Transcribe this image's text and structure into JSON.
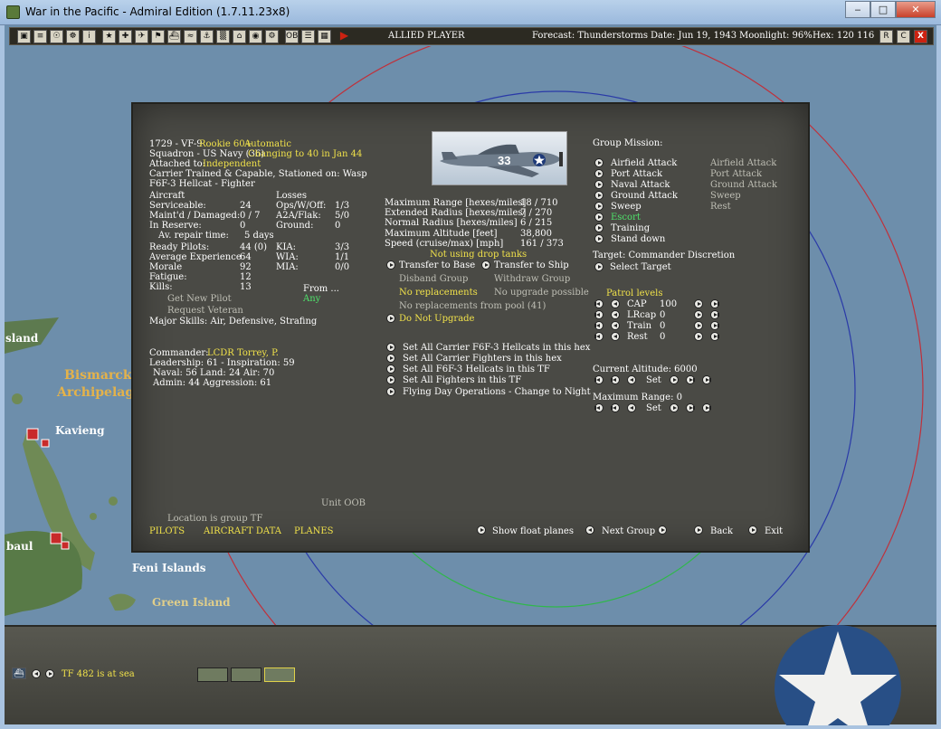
{
  "window": {
    "title": "War in the Pacific - Admiral Edition (1.7.11.23x8)",
    "min": "‒",
    "max": "□",
    "close": "✕"
  },
  "toolbar": {
    "player": "ALLIED PLAYER",
    "forecast": "Forecast: Thunderstorms",
    "date": "Date: Jun 19, 1943",
    "moonlight": "Moonlight: 96%",
    "hex": "Hex: 120 116",
    "icons": [
      "▣",
      "≡",
      "☉",
      "☸",
      "i",
      "★",
      "✚",
      "✈",
      "⚑",
      "⛴",
      "≈",
      "⚓",
      "▒",
      "⌂",
      "◉",
      "⚙",
      "OB",
      "☰",
      "▦"
    ],
    "right_icons": [
      "R",
      "C",
      "X"
    ]
  },
  "map": {
    "labels": {
      "island": "sland",
      "bismarck1": "Bismarck",
      "bismarck2": "Archipelago",
      "kavieng": "Kavieng",
      "rabaul": "baul",
      "feni": "Feni Islands",
      "green": "Green Island"
    }
  },
  "unit": {
    "line1_id": "1729 - VF-9",
    "line1_status": "Rookie 60+",
    "line1_mode": "Automatic",
    "squadron": "Squadron - US Navy (36)",
    "changing": "Changing to 40 in Jan 44",
    "attached_label": "Attached to:",
    "attached_value": "Independent",
    "carrier": "Carrier Trained & Capable, Stationed on:  Wasp",
    "aircraft_type": "F6F-3 Hellcat - Fighter"
  },
  "stats": {
    "aircraft_hdr": "Aircraft",
    "losses_hdr": "Losses",
    "serviceable_l": "Serviceable:",
    "serviceable_v": "24",
    "maintd_l": "Maint'd / Damaged:",
    "maintd_v": "0 / 7",
    "reserve_l": "In Reserve:",
    "reserve_v": "0",
    "repair_l": "Av. repair time:",
    "repair_v": "5 days",
    "opsw_l": "Ops/W/Off:",
    "opsw_v": "1/3",
    "a2a_l": "A2A/Flak:",
    "a2a_v": "5/0",
    "ground_l": "Ground:",
    "ground_v": "0",
    "ready_l": "Ready Pilots:",
    "ready_v": "44 (0)",
    "avgexp_l": "Average Experience",
    "avgexp_v": "64",
    "morale_l": "Morale",
    "morale_v": "92",
    "fatigue_l": "Fatigue:",
    "fatigue_v": "12",
    "kills_l": "Kills:",
    "kills_v": "13",
    "kia_l": "KIA:",
    "kia_v": "3/3",
    "wia_l": "WIA:",
    "wia_v": "1/1",
    "mia_l": "MIA:",
    "mia_v": "0/0",
    "get_pilot": "Get New Pilot",
    "req_vet": "Request Veteran",
    "from": "From ...",
    "any": "Any",
    "skills": "Major Skills:  Air, Defensive, Strafing"
  },
  "commander": {
    "label": "Commander:",
    "name": "LCDR Torrey, P.",
    "leadership": "Leadership: 61 - Inspiration: 59",
    "naval": "Naval:  56  Land:  24  Air:  70",
    "admin": "Admin:  44  Aggression:  61"
  },
  "performance": {
    "range_l": "Maximum Range [hexes/miles]",
    "range_v": "18 / 710",
    "ext_l": "Extended Radius [hexes/miles]",
    "ext_v": "7 / 270",
    "norm_l": "Normal Radius [hexes/miles]",
    "norm_v": "6 / 215",
    "alt_l": "Maximum Altitude [feet]",
    "alt_v": "38,800",
    "speed_l": "Speed (cruise/max) [mph]",
    "speed_v": "161 / 373",
    "drop_tanks": "Not using drop tanks"
  },
  "transfer": {
    "to_base": "Transfer to Base",
    "to_ship": "Transfer to Ship",
    "disband": "Disband Group",
    "withdraw": "Withdraw Group",
    "no_repl": "No replacements",
    "no_upg": "No upgrade possible",
    "pool": "No replacements from pool (41)",
    "do_not_upgrade": "Do Not Upgrade"
  },
  "set_all": {
    "a": "Set All Carrier F6F-3 Hellcats in this hex",
    "b": "Set All Carrier Fighters in this hex",
    "c": "Set All F6F-3 Hellcats in this TF",
    "d": "Set All Fighters in this TF",
    "e": "Flying Day Operations - Change to Night"
  },
  "mission": {
    "title": "Group Mission:",
    "options": [
      "Airfield Attack",
      "Port Attack",
      "Naval Attack",
      "Ground Attack",
      "Sweep",
      "Escort",
      "Training",
      "Stand down"
    ],
    "secondary": [
      "Airfield Attack",
      "Port Attack",
      "Ground Attack",
      "Sweep",
      "Rest"
    ],
    "target": "Target: Commander Discretion",
    "select_target": "Select Target"
  },
  "patrol": {
    "title": "Patrol levels",
    "rows": [
      {
        "name": "CAP",
        "value": "100"
      },
      {
        "name": "LRcap",
        "value": "0"
      },
      {
        "name": "Train",
        "value": "0"
      },
      {
        "name": "Rest",
        "value": "0"
      }
    ]
  },
  "altitude": {
    "current": "Current Altitude: 6000",
    "set": "Set",
    "max_range": "Maximum Range: 0"
  },
  "footer": {
    "unit_oob": "Unit OOB",
    "location": "Location is group TF",
    "pilots": "PILOTS",
    "aircraft_data": "AIRCRAFT DATA",
    "planes": "PLANES",
    "float": "Show float planes",
    "next_group": "Next Group",
    "back": "Back",
    "exit": "Exit"
  },
  "plane_marking": "33",
  "status": {
    "tf": "TF 482 is at sea"
  },
  "colors": {
    "panel": "#4a4a45",
    "highlight": "#f0e14a",
    "active": "#4fe36b",
    "sea": "#6d8eab"
  }
}
